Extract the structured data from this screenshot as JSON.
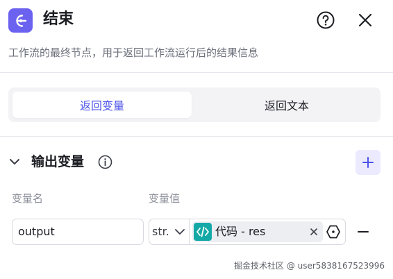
{
  "header": {
    "title": "结束",
    "description": "工作流的最终节点，用于返回工作流运行后的结果信息"
  },
  "tabs": [
    {
      "label": "返回变量",
      "active": true
    },
    {
      "label": "返回文本",
      "active": false
    }
  ],
  "output_section": {
    "title": "输出变量",
    "columns": {
      "name": "变量名",
      "value": "变量值"
    },
    "rows": [
      {
        "name": "output",
        "type": "str.",
        "reference": {
          "icon": "code-icon",
          "text": "代码 - res"
        }
      }
    ]
  },
  "watermark": "掘金技术社区 @ user5838167523996",
  "colors": {
    "accent": "#4d53e8",
    "node_icon_bg": "#6c62f0",
    "code_chip_bg": "#14a9a7",
    "add_button_bg": "#eceaff"
  }
}
